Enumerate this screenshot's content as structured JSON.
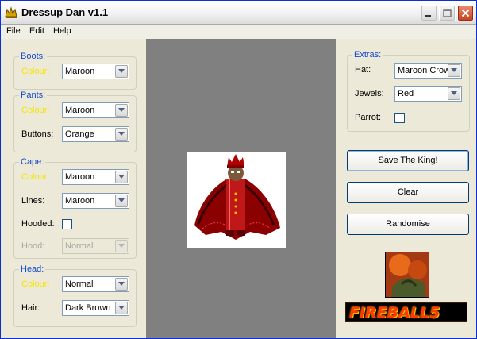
{
  "window": {
    "title": "Dressup Dan v1.1"
  },
  "menu": {
    "file": "File",
    "edit": "Edit",
    "help": "Help"
  },
  "boots": {
    "legend": "Boots:",
    "colour_label": "Colour:",
    "colour_value": "Maroon"
  },
  "pants": {
    "legend": "Pants:",
    "colour_label": "Colour:",
    "colour_value": "Maroon",
    "buttons_label": "Buttons:",
    "buttons_value": "Orange"
  },
  "cape": {
    "legend": "Cape:",
    "colour_label": "Colour:",
    "colour_value": "Maroon",
    "lines_label": "Lines:",
    "lines_value": "Maroon",
    "hooded_label": "Hooded:",
    "hooded_checked": false,
    "hood_label": "Hood:",
    "hood_value": "Normal"
  },
  "head": {
    "legend": "Head:",
    "colour_label": "Colour:",
    "colour_value": "Normal",
    "hair_label": "Hair:",
    "hair_value": "Dark Brown"
  },
  "extras": {
    "legend": "Extras:",
    "hat_label": "Hat:",
    "hat_value": "Maroon Crown",
    "jewels_label": "Jewels:",
    "jewels_value": "Red",
    "parrot_label": "Parrot:",
    "parrot_checked": false
  },
  "buttons": {
    "save": "Save The King!",
    "clear": "Clear",
    "randomise": "Randomise"
  },
  "banner": {
    "text": "FIREBALL5"
  },
  "colors": {
    "accent_label": "#1148cf",
    "colour_label": "#f5e600",
    "canvas": "#808080",
    "banner_text": "#ff3a00"
  }
}
